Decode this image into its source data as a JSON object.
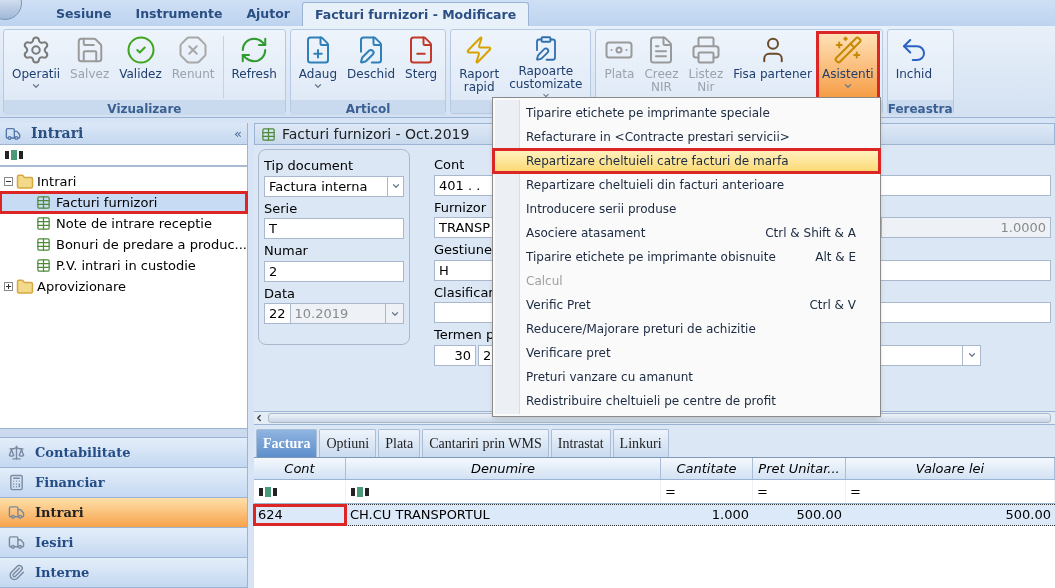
{
  "ribbon_tabs": [
    {
      "label": "Sesiune",
      "selected": false
    },
    {
      "label": "Instrumente",
      "selected": false
    },
    {
      "label": "Ajutor",
      "selected": false
    },
    {
      "label": "Facturi furnizori - Modificare",
      "selected": true
    }
  ],
  "ribbon_groups": [
    {
      "label": "Vizualizare",
      "buttons": [
        {
          "label": "Operatii",
          "disabled": false,
          "dropdown": true
        },
        {
          "label": "Salvez",
          "disabled": true,
          "dropdown": false
        },
        {
          "label": "Validez",
          "disabled": false,
          "dropdown": false
        },
        {
          "label": "Renunt",
          "disabled": true,
          "dropdown": false
        },
        {
          "label": "Refresh",
          "disabled": false,
          "dropdown": false
        }
      ]
    },
    {
      "label": "Articol",
      "buttons": [
        {
          "label": "Adaug",
          "disabled": false,
          "dropdown": true
        },
        {
          "label": "Deschid",
          "disabled": false,
          "dropdown": false
        },
        {
          "label": "Sterg",
          "disabled": false,
          "dropdown": false
        }
      ]
    },
    {
      "buttons": [
        {
          "label": "Raport\nrapid",
          "disabled": false,
          "dropdown": false
        },
        {
          "label": "Rapoarte\ncustomizate",
          "disabled": false,
          "dropdown": true
        }
      ]
    },
    {
      "buttons": [
        {
          "label": "Plata",
          "disabled": true,
          "dropdown": false
        },
        {
          "label": "Creez\nNIR",
          "disabled": true,
          "dropdown": false
        },
        {
          "label": "Listez\nNir",
          "disabled": true,
          "dropdown": false
        },
        {
          "label": "Fisa partener",
          "disabled": false,
          "dropdown": false
        },
        {
          "label": "Asistenti",
          "disabled": false,
          "dropdown": true,
          "pressed": true,
          "annotated": true
        }
      ]
    },
    {
      "label": "Fereastra",
      "buttons": [
        {
          "label": "Inchid",
          "disabled": false,
          "dropdown": false
        }
      ]
    }
  ],
  "navigator": {
    "title": "Intrari",
    "collapse": "«",
    "tree": [
      {
        "label": "Intrari",
        "selected": false,
        "expanded": true,
        "children": [
          {
            "label": "Facturi furnizori",
            "selected": true,
            "annotated": true
          },
          {
            "label": "Note de intrare receptie",
            "selected": false,
            "annotated": false
          },
          {
            "label": "Bonuri de predare a produc...",
            "selected": false,
            "annotated": false
          },
          {
            "label": "P.V. intrari in custodie",
            "selected": false,
            "annotated": false
          }
        ]
      },
      {
        "label": "Aprovizionare",
        "selected": false,
        "expanded": false
      }
    ],
    "modules": [
      {
        "label": "Contabilitate",
        "selected": false
      },
      {
        "label": "Financiar",
        "selected": false
      },
      {
        "label": "Intrari",
        "selected": true
      },
      {
        "label": "Iesiri",
        "selected": false
      },
      {
        "label": "Interne",
        "selected": false
      }
    ]
  },
  "document": {
    "title": "Facturi furnizori - Oct.2019",
    "tip_document": {
      "label": "Tip document",
      "value": "Factura interna"
    },
    "serie": {
      "label": "Serie",
      "value": "T"
    },
    "numar": {
      "label": "Numar",
      "value": "2"
    },
    "data": {
      "label": "Data",
      "day": "22",
      "rest": "10.2019"
    },
    "cont": {
      "label": "Cont",
      "value": "401 . ."
    },
    "furnizor": {
      "label": "Furnizor",
      "value": "TRANSP",
      "rate": "1.0000"
    },
    "gestiune": {
      "label": "Gestiune",
      "value": "H"
    },
    "clasificare": {
      "label": "Clasificar"
    },
    "termen": {
      "label": "Termen p",
      "days": "30",
      "value": "2"
    }
  },
  "detail_tabs": [
    {
      "label": "Factura",
      "selected": true
    },
    {
      "label": "Optiuni",
      "selected": false
    },
    {
      "label": "Plata",
      "selected": false
    },
    {
      "label": "Cantariri prin WMS",
      "selected": false
    },
    {
      "label": "Intrastat",
      "selected": false
    },
    {
      "label": "Linkuri",
      "selected": false
    }
  ],
  "table": {
    "columns": [
      {
        "label": "Cont",
        "kind": "text"
      },
      {
        "label": "Denumire",
        "kind": "text"
      },
      {
        "label": "Cantitate",
        "kind": "equals",
        "symbol": "="
      },
      {
        "label": "Pret Unitar...",
        "kind": "equals",
        "symbol": "="
      },
      {
        "label": "Valoare lei",
        "kind": "equals",
        "symbol": "="
      }
    ],
    "rows": [
      {
        "selected": true,
        "cells": [
          {
            "text": "624",
            "annotated": true
          },
          {
            "text": "CH.CU TRANSPORTUL",
            "annotated": false
          },
          {
            "text": "1.000",
            "annotated": false
          },
          {
            "text": "500.00",
            "annotated": false
          },
          {
            "text": "500.00",
            "annotated": false
          }
        ]
      }
    ]
  },
  "menu": {
    "items": [
      {
        "label": "Tiparire etichete pe imprimante speciale",
        "disabled": false,
        "selected": false
      },
      {
        "label": "Refacturare in <Contracte prestari servicii>",
        "disabled": false,
        "selected": false
      },
      {
        "label": "Repartizare cheltuieli catre facturi de marfa",
        "disabled": false,
        "selected": true,
        "annotated": true
      },
      {
        "label": "Repartizare cheltuieli din facturi anterioare",
        "disabled": false,
        "selected": false
      },
      {
        "label": "Introducere serii produse",
        "disabled": false,
        "selected": false
      },
      {
        "label": "Asociere atasament",
        "shortcut": "Ctrl & Shift & A",
        "disabled": false,
        "selected": false
      },
      {
        "label": "Tiparire etichete pe imprimante obisnuite",
        "shortcut": "Alt & E",
        "disabled": false,
        "selected": false
      },
      {
        "label": "Calcul",
        "disabled": true,
        "selected": false
      },
      {
        "label": "Verific Pret",
        "shortcut": "Ctrl & V",
        "disabled": false,
        "selected": false
      },
      {
        "label": "Reducere/Majorare preturi de achizitie",
        "disabled": false,
        "selected": false
      },
      {
        "label": "Verificare pret",
        "disabled": false,
        "selected": false
      },
      {
        "label": "Preturi vanzare cu amanunt",
        "disabled": false,
        "selected": false
      },
      {
        "label": "Redistribuire cheltuieli pe centre de profit",
        "disabled": false,
        "selected": false
      }
    ]
  }
}
